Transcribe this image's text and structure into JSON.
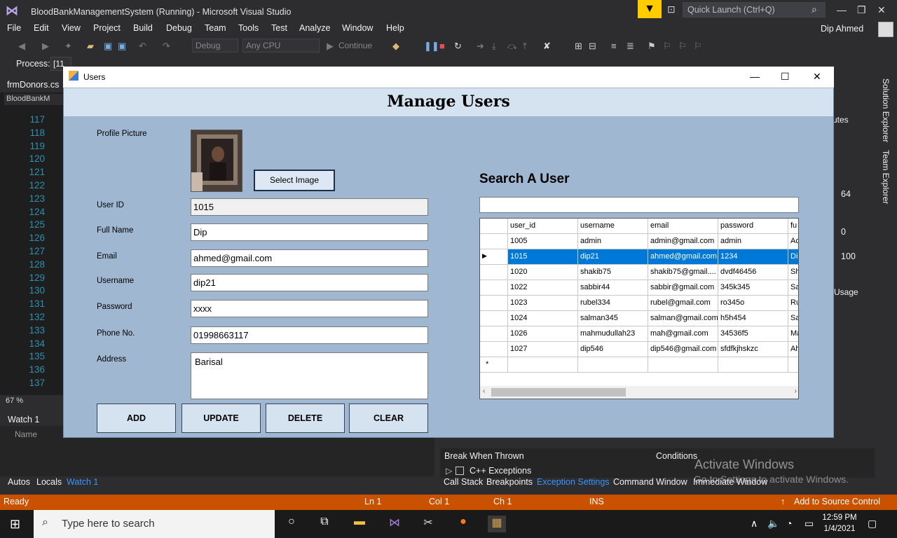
{
  "vs": {
    "title": "BloodBankManagementSystem (Running) - Microsoft Visual Studio",
    "quick_launch": "Quick Launch (Ctrl+Q)",
    "user": "Dip Ahmed",
    "menu": [
      "File",
      "Edit",
      "View",
      "Project",
      "Build",
      "Debug",
      "Team",
      "Tools",
      "Test",
      "Analyze",
      "Window",
      "Help"
    ],
    "config": "Debug",
    "platform": "Any CPU",
    "continue": "Continue",
    "process_label": "Process:",
    "process_value": "[11",
    "doc_tab": "frmDonors.cs",
    "code_nav": "BloodBankM",
    "line_numbers": [
      "117",
      "118",
      "119",
      "120",
      "121",
      "122",
      "123",
      "124",
      "125",
      "126",
      "127",
      "128",
      "129",
      "130",
      "131",
      "132",
      "133",
      "134",
      "135",
      "136",
      "137"
    ],
    "zoom": "67 %",
    "watch_title": "Watch 1",
    "watch_name_col": "Name",
    "bottom_tabs": [
      "Autos",
      "Locals",
      "Watch 1"
    ],
    "exception_cols": [
      "Break When Thrown",
      "Conditions"
    ],
    "exception_item": "C++ Exceptions",
    "bottom_tabs_right": [
      "Call Stack",
      "Breakpoints",
      "Exception Settings",
      "Command Window",
      "Immediate Window"
    ],
    "side_tabs": [
      "Solution Explorer",
      "Team Explorer"
    ],
    "right_values": [
      "64",
      "0",
      "100"
    ],
    "right_labels": [
      "utes",
      "Usage"
    ],
    "activate_title": "Activate Windows",
    "activate_sub": "Go to Settings to activate Windows."
  },
  "status": {
    "ready": "Ready",
    "ln": "Ln 1",
    "col": "Col 1",
    "ch": "Ch 1",
    "ins": "INS",
    "source_control": "Add to Source Control"
  },
  "taskbar": {
    "search_placeholder": "Type here to search",
    "time": "12:59 PM",
    "date": "1/4/2021"
  },
  "form": {
    "window_title": "Users",
    "header": "Manage Users",
    "labels": {
      "profile": "Profile Picture",
      "user_id": "User ID",
      "full_name": "Full Name",
      "email": "Email",
      "username": "Username",
      "password": "Password",
      "phone": "Phone No.",
      "address": "Address"
    },
    "values": {
      "user_id": "1015",
      "full_name": "Dip",
      "email": "ahmed@gmail.com",
      "username": "dip21",
      "password": "xxxx",
      "phone": "01998663117",
      "address": "Barisal"
    },
    "select_image": "Select Image",
    "buttons": {
      "add": "ADD",
      "update": "UPDATE",
      "delete": "DELETE",
      "clear": "CLEAR"
    },
    "search_title": "Search A User",
    "search_value": ""
  },
  "grid": {
    "columns": [
      "user_id",
      "username",
      "email",
      "password",
      "fu"
    ],
    "rows": [
      [
        "1005",
        "admin",
        "admin@gmail.com",
        "admin",
        "Ac"
      ],
      [
        "1015",
        "dip21",
        "ahmed@gmail.com",
        "1234",
        "Di"
      ],
      [
        "1020",
        "shakib75",
        "shakib75@gmail....",
        "dvdf46456",
        "Sh"
      ],
      [
        "1022",
        "sabbir44",
        "sabbir@gmail.com",
        "345k345",
        "Sa"
      ],
      [
        "1023",
        "rubel334",
        "rubel@gmail.com",
        "ro345o",
        "Ru"
      ],
      [
        "1024",
        "salman345",
        "salman@gmail.com",
        "h5h454",
        "Sa"
      ],
      [
        "1026",
        "mahmudullah23",
        "mah@gmail.com",
        "34536f5",
        "Ma"
      ],
      [
        "1027",
        "dip546",
        "dip546@gmail.com",
        "sfdfkjhskzc",
        "Ah"
      ]
    ],
    "selected_row": 1,
    "selected_marker": "▶",
    "new_row_marker": "*"
  }
}
